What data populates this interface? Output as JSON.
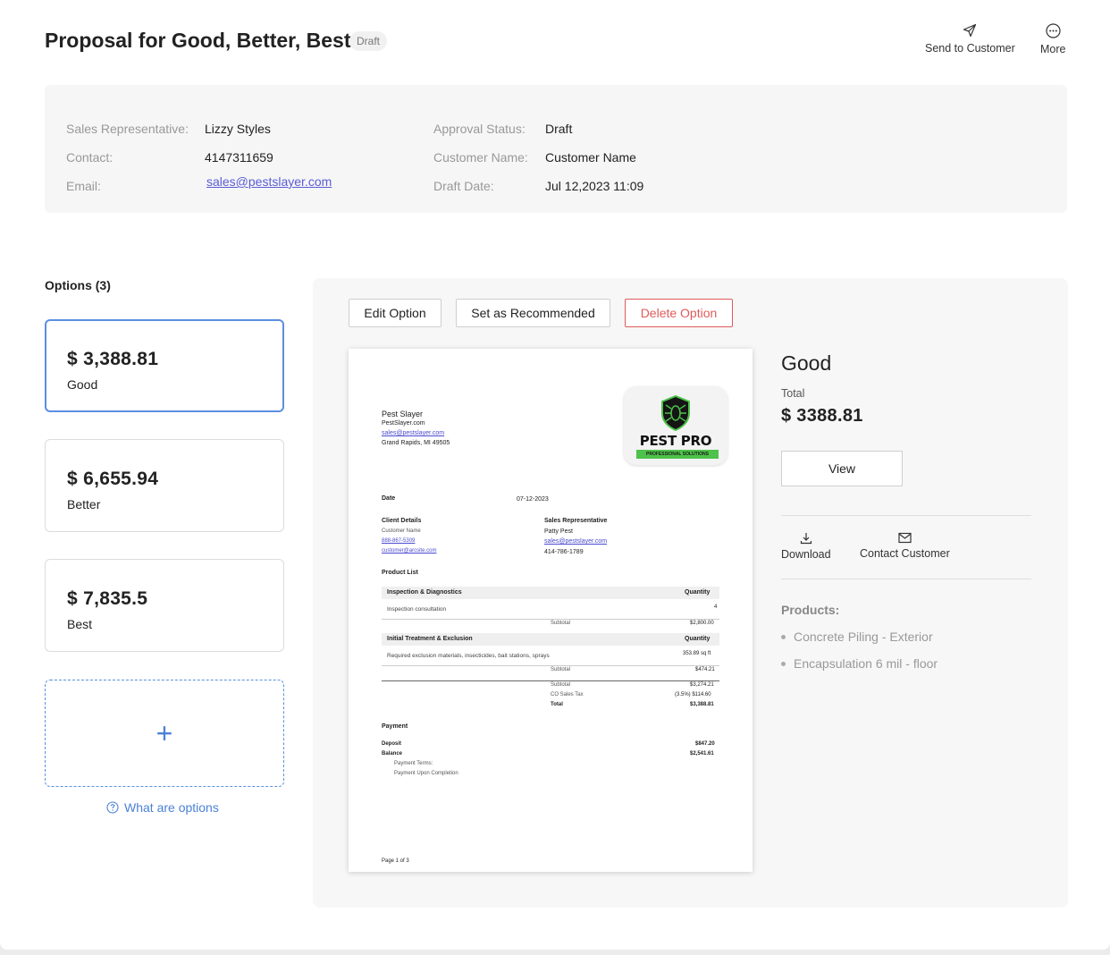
{
  "header": {
    "title": "Proposal for Good, Better, Best",
    "status_badge": "Draft",
    "actions": [
      {
        "label": "Send to Customer",
        "icon": "send-icon"
      },
      {
        "label": "More",
        "icon": "more-icon"
      }
    ]
  },
  "info": {
    "sales_rep_label": "Sales Representative:",
    "sales_rep": "Lizzy Styles",
    "contact_label": "Contact:",
    "contact": "4147311659",
    "email_label": "Email:",
    "email": "sales@pestslayer.com",
    "approval_label": "Approval Status:",
    "approval": "Draft",
    "customer_label": "Customer Name:",
    "customer": "Customer Name",
    "draft_date_label": "Draft Date:",
    "draft_date": "Jul 12,2023 11:09"
  },
  "options": {
    "heading": "Options (3)",
    "items": [
      {
        "price": "$ 3,388.81",
        "name": "Good",
        "active": true
      },
      {
        "price": "$ 6,655.94",
        "name": "Better",
        "active": false
      },
      {
        "price": "$ 7,835.5",
        "name": "Best",
        "active": false
      }
    ],
    "add_symbol": "+",
    "help_link": "What are options"
  },
  "toolbar": {
    "edit_label": "Edit Option",
    "recommend_label": "Set as Recommended",
    "delete_label": "Delete Option"
  },
  "document": {
    "company": "Pest Slayer",
    "company_site": "PestSlayer.com",
    "company_email": "sales@pestslayer.com",
    "company_city": "Grand Rapids, MI 49505",
    "logo_text": "PEST PRO",
    "logo_tagline": "PROFESSIONAL SOLUTIONS",
    "date_label": "Date",
    "date": "07-12-2023",
    "client_heading": "Client Details",
    "client_name": "Customer Name",
    "client_phone": "888-867-5309",
    "client_email": "customer@arcsite.com",
    "rep_heading": "Sales Representative",
    "rep_name": "Patty Pest",
    "rep_email": "sales@pestslayer.com",
    "rep_phone": "414-786-1789",
    "product_list_label": "Product List",
    "quantity_label": "Quantity",
    "subtotal_label": "Subtotal",
    "section1_title": "Inspection & Diagnostics",
    "section1_item": "Inspection consultation",
    "section1_qty": "4",
    "section1_subtotal": "$2,800.00",
    "section2_title": "Initial Treatment & Exclusion",
    "section2_item": "Required exclusion materials, insecticides, bait stations, sprays",
    "section2_qty": "353.89 sq ft",
    "section2_subtotal": "$474.21",
    "summary_subtotal": "$3,274.21",
    "tax_label": "CO Sales Tax",
    "tax_value": "(3.5%) $114.60",
    "total_label": "Total",
    "total_value": "$3,388.81",
    "payment_heading": "Payment",
    "deposit_label": "Deposit",
    "deposit_value": "$847.20",
    "balance_label": "Balance",
    "balance_value": "$2,541.61",
    "terms_label": "Payment Terms:",
    "terms_value": "Payment Upon Completion",
    "page_indicator": "Page 1 of 3"
  },
  "summary": {
    "title": "Good",
    "total_label": "Total",
    "total": "$ 3388.81",
    "view_label": "View",
    "download_label": "Download",
    "contact_label": "Contact Customer",
    "products_label": "Products:",
    "products": [
      "Concrete Piling - Exterior",
      "Encapsulation 6 mil - floor"
    ]
  },
  "colors": {
    "accent": "#5b8fe0",
    "link": "#4b82d6",
    "danger": "#e05a5a",
    "logo_green": "#4ec24a"
  }
}
